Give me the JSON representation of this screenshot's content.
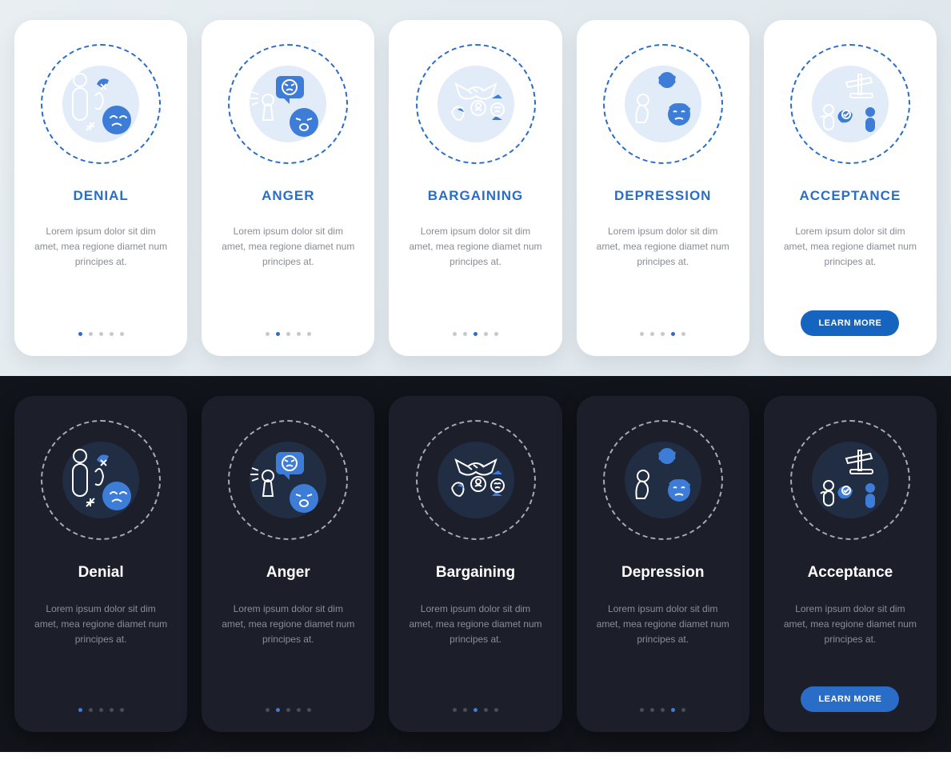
{
  "desc": "Lorem ipsum dolor sit dim amet, mea regione diamet num principes at.",
  "button_label": "LEARN MORE",
  "dots_count": 5,
  "light": {
    "cards": [
      {
        "title": "DENIAL",
        "icon": "denial"
      },
      {
        "title": "ANGER",
        "icon": "anger"
      },
      {
        "title": "BARGAINING",
        "icon": "bargaining"
      },
      {
        "title": "DEPRESSION",
        "icon": "depression"
      },
      {
        "title": "ACCEPTANCE",
        "icon": "acceptance"
      }
    ]
  },
  "dark": {
    "cards": [
      {
        "title": "Denial",
        "icon": "denial"
      },
      {
        "title": "Anger",
        "icon": "anger"
      },
      {
        "title": "Bargaining",
        "icon": "bargaining"
      },
      {
        "title": "Depression",
        "icon": "depression"
      },
      {
        "title": "Acceptance",
        "icon": "acceptance"
      }
    ]
  },
  "colors": {
    "accent": "#2a6dc8",
    "blue": "#3d7dd8",
    "dark_bg": "#1c1f2a"
  }
}
